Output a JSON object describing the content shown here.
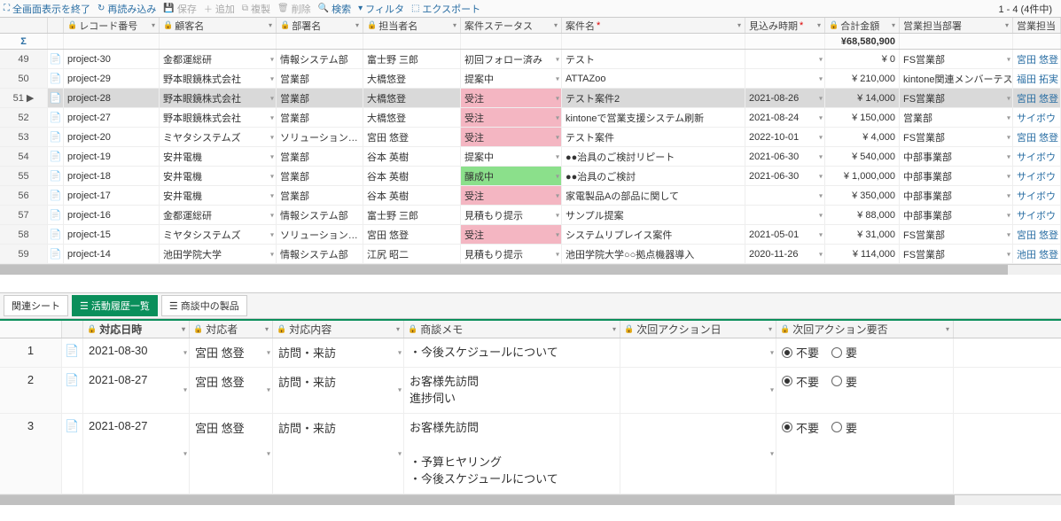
{
  "toolbar": {
    "exit_fullscreen": "全画面表示を終了",
    "reload": "再読み込み",
    "save": "保存",
    "add": "追加",
    "copy": "複製",
    "delete": "削除",
    "search": "検索",
    "filter": "フィルタ",
    "export": "エクスポート",
    "pager": "1 - 4  (4件中)"
  },
  "columns": {
    "record_no": "レコード番号",
    "customer": "顧客名",
    "department": "部署名",
    "owner": "担当者名",
    "status": "案件ステータス",
    "anken": "案件名",
    "anken_req": "*",
    "due": "見込み時期",
    "due_req": "*",
    "amount": "合計金額",
    "sales_dept": "営業担当部署",
    "sales_owner": "営業担当"
  },
  "total_amount": "¥68,580,900",
  "rows": [
    {
      "n": "49",
      "rec": "project-30",
      "cust": "金都運総研",
      "dept": "情報システム部",
      "owner": "富士野 三郎",
      "status": "初回フォロー済み",
      "stcls": "",
      "anken": "テスト",
      "due": "",
      "amt": "¥ 0",
      "sdept": "FS営業部",
      "sown": "宮田 悠登"
    },
    {
      "n": "50",
      "rec": "project-29",
      "cust": "野本眼鏡株式会社",
      "dept": "営業部",
      "owner": "大橋悠登",
      "status": "提案中",
      "stcls": "",
      "anken": "ATTAZoo",
      "due": "",
      "amt": "¥ 210,000",
      "sdept": "kintone関連メンバーテスト_福田",
      "sown": "福田 拓実"
    },
    {
      "n": "51",
      "rec": "project-28",
      "cust": "野本眼鏡株式会社",
      "dept": "営業部",
      "owner": "大橋悠登",
      "status": "受注",
      "stcls": "stat-pink",
      "anken": "テスト案件2",
      "due": "2021-08-26",
      "amt": "¥ 14,000",
      "sdept": "FS営業部",
      "sown": "宮田 悠登",
      "sel": true,
      "arrow": true
    },
    {
      "n": "52",
      "rec": "project-27",
      "cust": "野本眼鏡株式会社",
      "dept": "営業部",
      "owner": "大橋悠登",
      "status": "受注",
      "stcls": "stat-pink",
      "anken": "kintoneで営業支援システム刷新",
      "due": "2021-08-24",
      "amt": "¥ 150,000",
      "sdept": "営業部",
      "sown": "サイボウ"
    },
    {
      "n": "53",
      "rec": "project-20",
      "cust": "ミヤタシステムズ",
      "dept": "ソリューション…",
      "owner": "宮田 悠登",
      "status": "受注",
      "stcls": "stat-pink",
      "anken": "テスト案件",
      "due": "2022-10-01",
      "amt": "¥ 4,000",
      "sdept": "FS営業部",
      "sown": "宮田 悠登"
    },
    {
      "n": "54",
      "rec": "project-19",
      "cust": "安井電機",
      "dept": "営業部",
      "owner": "谷本 英樹",
      "status": "提案中",
      "stcls": "",
      "anken": "●●治具のご検討リピート",
      "due": "2021-06-30",
      "amt": "¥ 540,000",
      "sdept": "中部事業部",
      "sown": "サイボウ"
    },
    {
      "n": "55",
      "rec": "project-18",
      "cust": "安井電機",
      "dept": "営業部",
      "owner": "谷本 英樹",
      "status": "醸成中",
      "stcls": "stat-green",
      "anken": "●●治具のご検討",
      "due": "2021-06-30",
      "amt": "¥ 1,000,000",
      "sdept": "中部事業部",
      "sown": "サイボウ"
    },
    {
      "n": "56",
      "rec": "project-17",
      "cust": "安井電機",
      "dept": "営業部",
      "owner": "谷本 英樹",
      "status": "受注",
      "stcls": "stat-pink",
      "anken": "家電製品Aの部品に関して",
      "due": "",
      "amt": "¥ 350,000",
      "sdept": "中部事業部",
      "sown": "サイボウ"
    },
    {
      "n": "57",
      "rec": "project-16",
      "cust": "金都運総研",
      "dept": "情報システム部",
      "owner": "富士野 三郎",
      "status": "見積もり提示",
      "stcls": "",
      "anken": "サンプル提案",
      "due": "",
      "amt": "¥ 88,000",
      "sdept": "中部事業部",
      "sown": "サイボウ"
    },
    {
      "n": "58",
      "rec": "project-15",
      "cust": "ミヤタシステムズ",
      "dept": "ソリューション…",
      "owner": "宮田 悠登",
      "status": "受注",
      "stcls": "stat-pink",
      "anken": "システムリプレイス案件",
      "due": "2021-05-01",
      "amt": "¥ 31,000",
      "sdept": "FS営業部",
      "sown": "宮田 悠登"
    },
    {
      "n": "59",
      "rec": "project-14",
      "cust": "池田学院大学",
      "dept": "情報システム部",
      "owner": "江尻 昭二",
      "status": "見積もり提示",
      "stcls": "",
      "anken": "池田学院大学○○拠点機器導入",
      "due": "2020-11-26",
      "amt": "¥ 114,000",
      "sdept": "FS営業部",
      "sown": "池田 悠登"
    }
  ],
  "tabs": {
    "related": "関連シート",
    "activity": "活動履歴一覧",
    "products": "商談中の製品"
  },
  "sub_columns": {
    "date": "対応日時",
    "person": "対応者",
    "content": "対応内容",
    "memo": "商談メモ",
    "next_date": "次回アクション日",
    "next_action": "次回アクション要否"
  },
  "sub_rows": [
    {
      "n": "1",
      "date": "2021-08-30",
      "person": "宮田 悠登",
      "content": "訪問・来訪",
      "memo": "・今後スケジュールについて",
      "action": "不要"
    },
    {
      "n": "2",
      "date": "2021-08-27",
      "person": "宮田 悠登",
      "content": "訪問・来訪",
      "memo": "お客様先訪問\n進捗伺い",
      "action": "不要"
    },
    {
      "n": "3",
      "date": "2021-08-27",
      "person": "宮田 悠登",
      "content": "訪問・来訪",
      "memo": "お客様先訪問\n\n・予算ヒヤリング\n・今後スケジュールについて",
      "action": "不要"
    }
  ],
  "radio_labels": {
    "no": "不要",
    "yes": "要"
  }
}
